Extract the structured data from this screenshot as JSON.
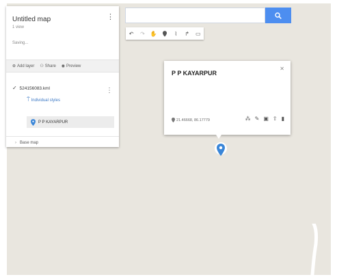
{
  "panel": {
    "title": "Untitled map",
    "views": "1 view",
    "status": "Saving...",
    "actions": {
      "add_layer": "Add layer",
      "share": "Share",
      "preview": "Preview"
    },
    "layer": {
      "name": "524156083.kml",
      "styles_link": "Individual styles",
      "placemark": "P P KAYARPUR"
    },
    "base_map": "Base map"
  },
  "search": {
    "value": "",
    "placeholder": ""
  },
  "card": {
    "name": "P P KAYARPUR",
    "coords": "21.46668, 86.17779"
  },
  "colors": {
    "accent": "#4d8ef0",
    "map_background": "#e9e6df",
    "pin": "#3a86d8"
  },
  "icons": {
    "search": "search-icon",
    "undo": "undo-icon",
    "redo": "redo-icon",
    "hand": "hand-icon",
    "marker": "marker-icon",
    "line": "draw-line-icon",
    "directions": "directions-icon",
    "ruler": "ruler-icon"
  }
}
